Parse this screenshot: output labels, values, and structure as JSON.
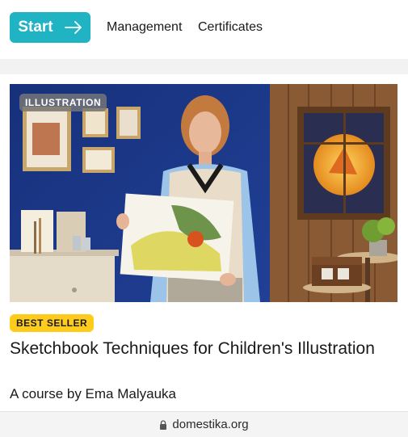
{
  "header": {
    "start_label": "Start",
    "nav": [
      {
        "label": "Management"
      },
      {
        "label": "Certificates"
      }
    ]
  },
  "course": {
    "category_badge": "ILLUSTRATION",
    "seller_badge": "BEST SELLER",
    "title": "Sketchbook Techniques for Children's Illustration",
    "byline": "A course by Ema Malyauka"
  },
  "browser": {
    "url": "domestika.org"
  },
  "colors": {
    "accent": "#1fb3c4",
    "badge_yellow": "#ffcc1d",
    "hero_wall": "#1c3a8c",
    "wood": "#8a5a35"
  },
  "icons": {
    "start_arrow": "arrow-right-icon",
    "lock": "lock-icon"
  }
}
